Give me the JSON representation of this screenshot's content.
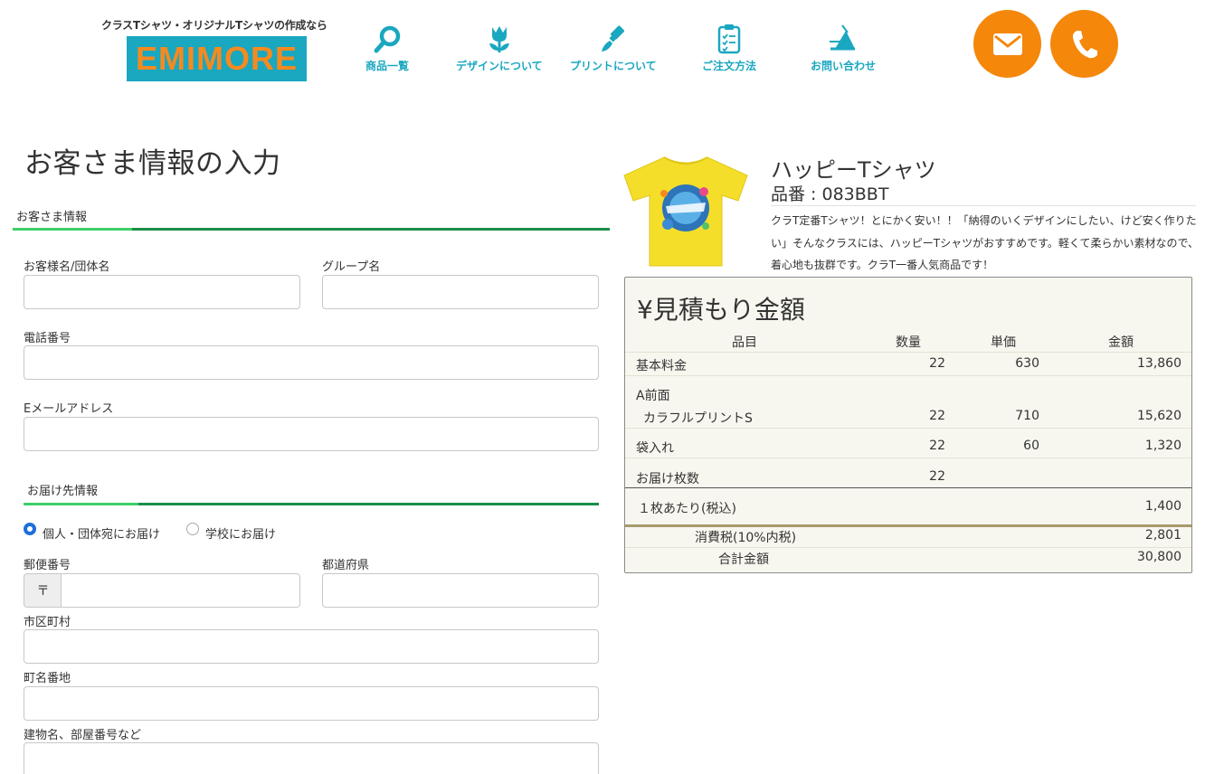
{
  "header": {
    "tagline": "クラスTシャツ・オリジナルTシャツの作成なら",
    "logo_text": "EMIMORE",
    "nav": [
      {
        "label": "商品一覧",
        "icon": "search-icon"
      },
      {
        "label": "デザインについて",
        "icon": "tulip-icon"
      },
      {
        "label": "プリントについて",
        "icon": "paintbrush-icon"
      },
      {
        "label": "ご注文方法",
        "icon": "clipboard-icon"
      },
      {
        "label": "お問い合わせ",
        "icon": "megaphone-icon"
      }
    ],
    "mail_icon": "mail-icon",
    "phone_icon": "phone-icon",
    "accent_color": "#1aa7c0",
    "button_color": "#f5870a"
  },
  "form": {
    "title": "お客さま情報の入力",
    "customer_section": "お客さま情報",
    "customer_name_label": "お客様名/団体名",
    "group_name_label": "グループ名",
    "phone_label": "電話番号",
    "email_label": "Eメールアドレス",
    "delivery_section": "お届け先情報",
    "radio_individual": "個人・団体宛にお届け",
    "radio_school": "学校にお届け",
    "postal_label": "郵便番号",
    "postal_prefix": "〒",
    "prefecture_label": "都道府県",
    "city_label": "市区町村",
    "street_label": "町名番地",
    "building_label": "建物名、部屋番号など"
  },
  "product": {
    "name": "ハッピーTシャツ",
    "code": "品番 : 083BBT",
    "description": "クラT定番Tシャツ！とにかく安い！！「納得のいくデザインにしたい、けど安く作りたい」そんなクラスには、ハッピーTシャツがおすすめです。軽くて柔らかい素材なので、着心地も抜群です。クラT一番人気商品です！",
    "shirt_color": "#f5de2a"
  },
  "estimate": {
    "title": "¥見積もり金額",
    "headers": {
      "item": "品目",
      "qty": "数量",
      "unit": "単価",
      "amount": "金額"
    },
    "base": {
      "item": "基本料金",
      "qty": "22",
      "unit": "630",
      "amount": "13,860"
    },
    "front_label": "A前面",
    "print": {
      "item": "カラフルプリントS",
      "qty": "22",
      "unit": "710",
      "amount": "15,620"
    },
    "bag": {
      "item": "袋入れ",
      "qty": "22",
      "unit": "60",
      "amount": "1,320"
    },
    "count": {
      "item": "お届け枚数",
      "qty": "22"
    },
    "per_item": {
      "label": "１枚あたり(税込)",
      "amount": "1,400"
    },
    "tax": {
      "label": "消費税(10%内税)",
      "amount": "2,801"
    },
    "total": {
      "label": "合計金額",
      "amount": "30,800"
    }
  }
}
